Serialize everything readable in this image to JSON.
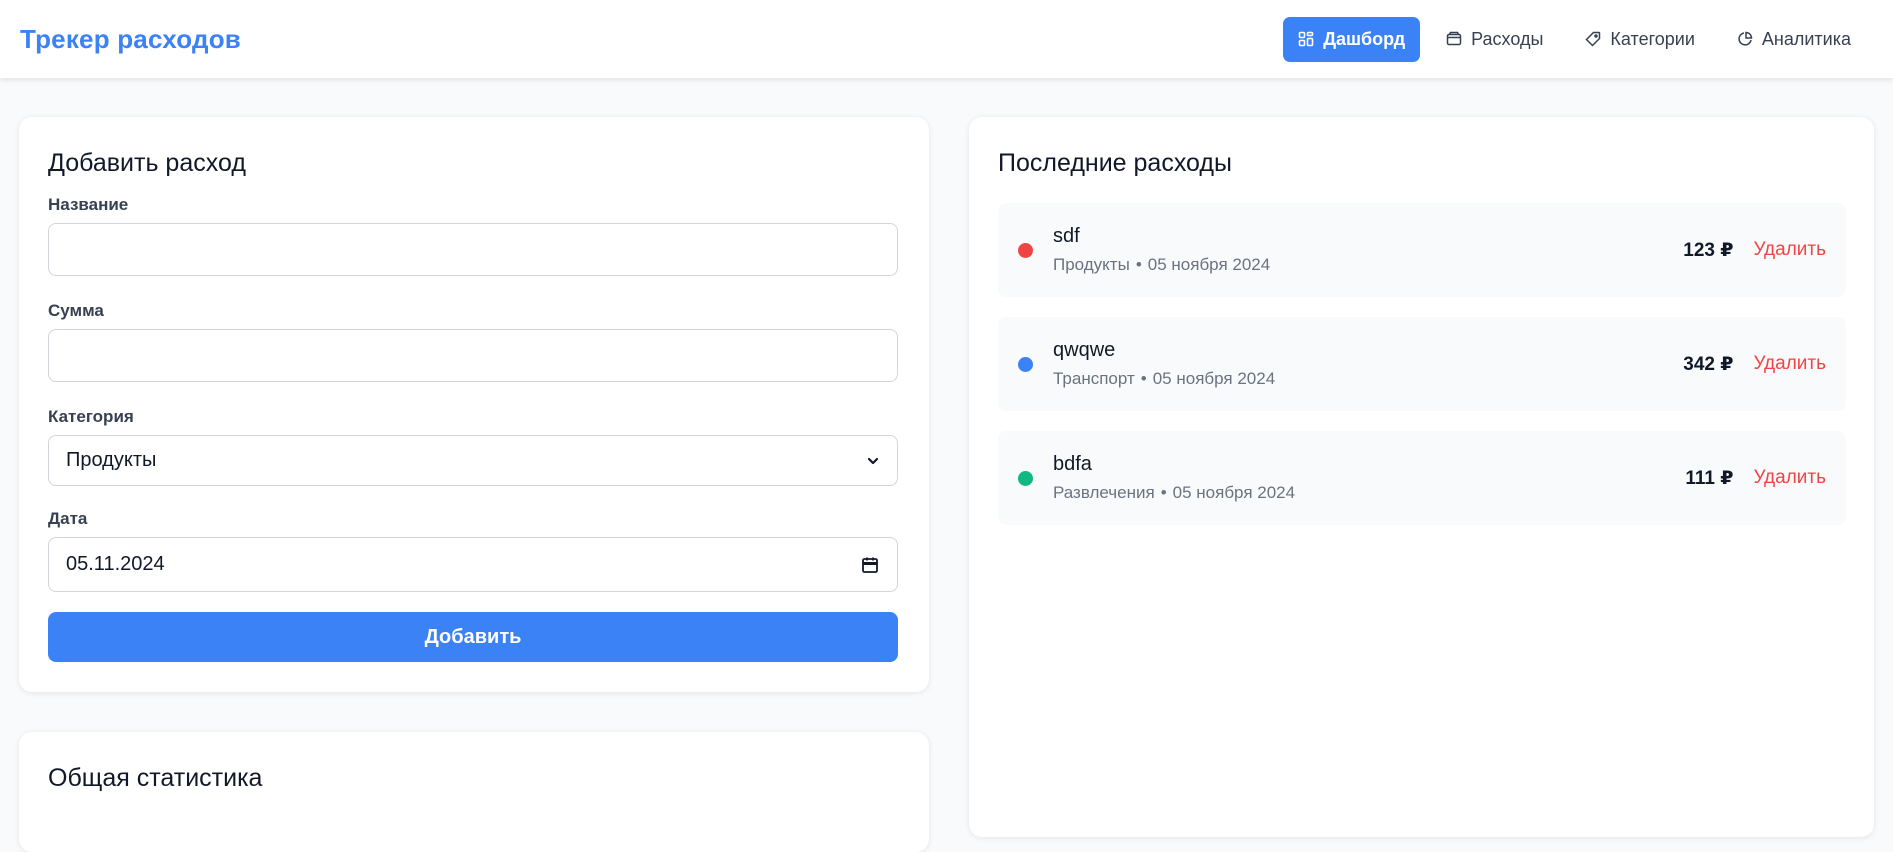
{
  "header": {
    "title": "Трекер расходов",
    "nav": [
      {
        "label": "Дашборд",
        "icon": "dashboard-icon"
      },
      {
        "label": "Расходы",
        "icon": "wallet-icon"
      },
      {
        "label": "Категории",
        "icon": "tag-icon"
      },
      {
        "label": "Аналитика",
        "icon": "pie-chart-icon"
      }
    ],
    "active_nav": "Дашборд",
    "accent_color": "#3b82f6"
  },
  "add_form": {
    "title": "Добавить расход",
    "name_label": "Название",
    "name_value": "",
    "amount_label": "Сумма",
    "amount_value": "",
    "category_label": "Категория",
    "category_value": "Продукты",
    "date_label": "Дата",
    "date_value": "05.11.2024",
    "submit_label": "Добавить"
  },
  "stats": {
    "title": "Общая статистика"
  },
  "recent": {
    "title": "Последние расходы",
    "delete_label": "Удалить",
    "separator": "•",
    "items": [
      {
        "name": "sdf",
        "category": "Продукты",
        "date": "05 ноября 2024",
        "amount": "123 ₽",
        "color": "#ef4444"
      },
      {
        "name": "qwqwe",
        "category": "Транспорт",
        "date": "05 ноября 2024",
        "amount": "342 ₽",
        "color": "#3b82f6"
      },
      {
        "name": "bdfa",
        "category": "Развлечения",
        "date": "05 ноября 2024",
        "amount": "111 ₽",
        "color": "#10b981"
      }
    ]
  }
}
